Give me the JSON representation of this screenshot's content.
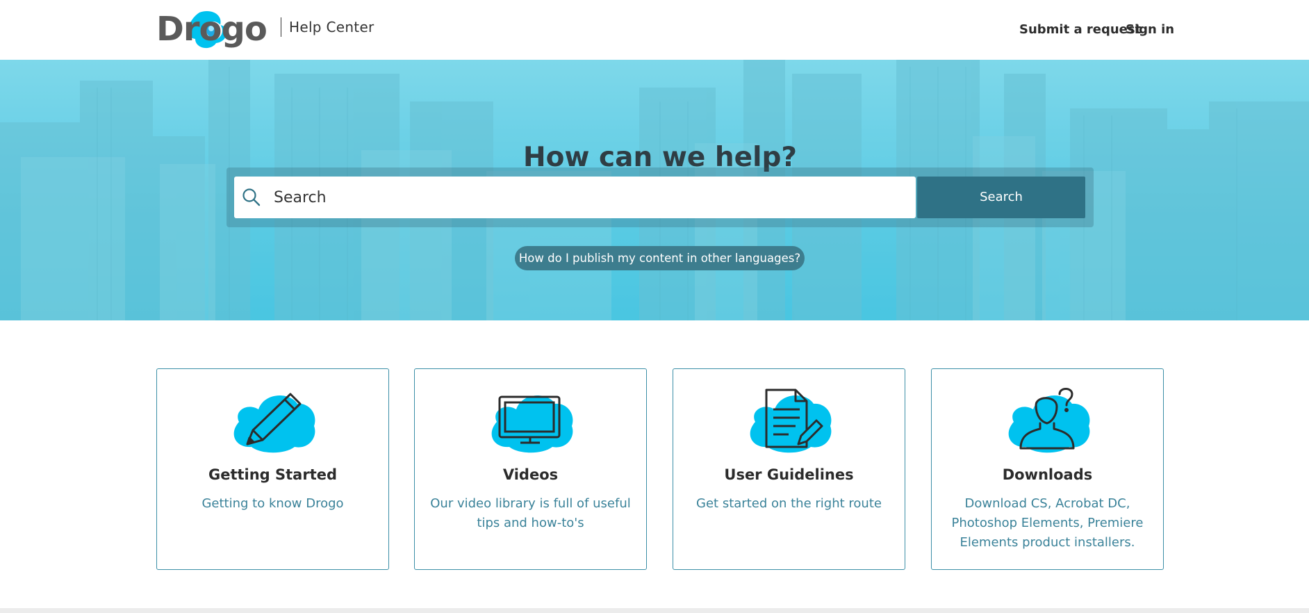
{
  "header": {
    "logo_text": "Drogo",
    "help_center": "Help Center",
    "nav": {
      "submit_request": "Submit a request",
      "sign_in": "Sign in"
    }
  },
  "hero": {
    "title": "How can we help?",
    "search": {
      "placeholder": "Search",
      "button_label": "Search",
      "icon": "search-icon"
    },
    "suggestion": "How do I publish my content in other languages?"
  },
  "cards": [
    {
      "title": "Getting Started",
      "description": "Getting to know Drogo",
      "icon": "pencil-icon"
    },
    {
      "title": "Videos",
      "description": "Our video library is full of useful tips and how-to's",
      "icon": "monitor-icon"
    },
    {
      "title": "User Guidelines",
      "description": "Get started on the right route",
      "icon": "document-icon"
    },
    {
      "title": "Downloads",
      "description": "Download CS, Acrobat DC, Photoshop Elements, Premiere Elements product installers.",
      "icon": "user-question-icon"
    }
  ],
  "colors": {
    "accent_blue": "#00c2ef",
    "search_button": "#2f7286",
    "card_border": "#3a8ea6",
    "card_text": "#3a8299",
    "hero": "#5cc8e0"
  }
}
